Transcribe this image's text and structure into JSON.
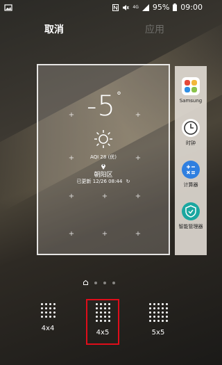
{
  "status_bar": {
    "battery": "95%",
    "time": "09:00",
    "network": "4G"
  },
  "actions": {
    "cancel_label": "取消",
    "apply_label": "应用"
  },
  "weather_widget": {
    "temperature": "-5",
    "degree": "°",
    "aqi": "AQI 28 (优)",
    "city": "朝阳区",
    "updated": "已更新 12/26 08:44"
  },
  "side_apps": [
    {
      "label": "Samsung",
      "icon": "samsung-apps-icon"
    },
    {
      "label": "时钟",
      "icon": "clock-icon"
    },
    {
      "label": "计算器",
      "icon": "calculator-icon"
    },
    {
      "label": "智能管理器",
      "icon": "smart-manager-icon"
    }
  ],
  "grid_options": [
    {
      "label": "4x4",
      "rows": 4,
      "cols": 4
    },
    {
      "label": "4x5",
      "rows": 5,
      "cols": 4
    },
    {
      "label": "5x5",
      "rows": 5,
      "cols": 5
    }
  ],
  "selected_grid": "4x5",
  "colors": {
    "highlight": "#e00d1a",
    "apply_disabled": "#6f6e6a"
  }
}
